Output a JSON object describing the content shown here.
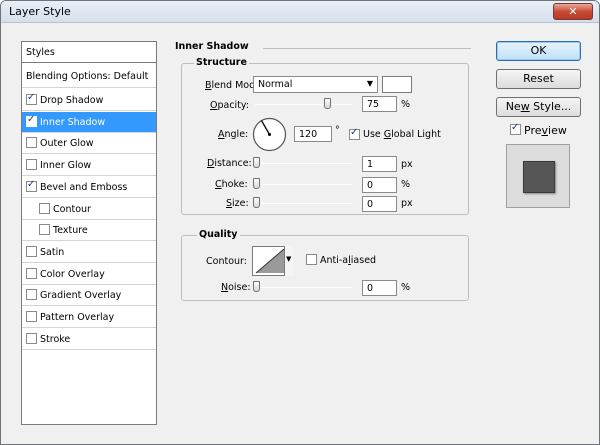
{
  "window": {
    "title": "Layer Style",
    "close_glyph": "✕"
  },
  "styles_list": {
    "header": "Styles",
    "blending": "Blending Options: Default",
    "items": [
      {
        "label": "Drop Shadow",
        "checked": true,
        "selected": false,
        "indent": false
      },
      {
        "label": "Inner Shadow",
        "checked": true,
        "selected": true,
        "indent": false
      },
      {
        "label": "Outer Glow",
        "checked": false,
        "selected": false,
        "indent": false
      },
      {
        "label": "Inner Glow",
        "checked": false,
        "selected": false,
        "indent": false
      },
      {
        "label": "Bevel and Emboss",
        "checked": true,
        "selected": false,
        "indent": false
      },
      {
        "label": "Contour",
        "checked": false,
        "selected": false,
        "indent": true
      },
      {
        "label": "Texture",
        "checked": false,
        "selected": false,
        "indent": true
      },
      {
        "label": "Satin",
        "checked": false,
        "selected": false,
        "indent": false
      },
      {
        "label": "Color Overlay",
        "checked": false,
        "selected": false,
        "indent": false
      },
      {
        "label": "Gradient Overlay",
        "checked": false,
        "selected": false,
        "indent": false
      },
      {
        "label": "Pattern Overlay",
        "checked": false,
        "selected": false,
        "indent": false
      },
      {
        "label": "Stroke",
        "checked": false,
        "selected": false,
        "indent": false
      }
    ]
  },
  "inner_shadow": {
    "title": "Inner Shadow",
    "structure": {
      "title": "Structure",
      "blend_mode_label_u": "B",
      "blend_mode_label_rest": "lend Mode:",
      "blend_mode_value": "Normal",
      "shadow_color": "#ffffff",
      "opacity_label_u": "O",
      "opacity_label_rest": "pacity:",
      "opacity_value": "75",
      "opacity_unit": "%",
      "opacity_level": 0.75,
      "angle_label_u": "A",
      "angle_label_rest": "ngle:",
      "angle_value": "120",
      "angle_unit": "°",
      "use_global_light_pre": "Use ",
      "use_global_light_u": "G",
      "use_global_light_post": "lobal Light",
      "use_global_light_checked": true,
      "distance_label_u": "D",
      "distance_label_rest": "istance:",
      "distance_value": "1",
      "distance_unit": "px",
      "choke_label_u": "C",
      "choke_label_rest": "hoke:",
      "choke_value": "0",
      "choke_unit": "%",
      "size_label_u": "S",
      "size_label_rest": "ize:",
      "size_value": "0",
      "size_unit": "px"
    },
    "quality": {
      "title": "Quality",
      "contour_label": "Contour:",
      "anti_aliased_pre": "Anti-a",
      "anti_aliased_u": "l",
      "anti_aliased_post": "iased",
      "anti_aliased_checked": false,
      "noise_label_u": "N",
      "noise_label_rest": "oise:",
      "noise_value": "0",
      "noise_unit": "%"
    }
  },
  "buttons": {
    "ok": "OK",
    "reset": "Reset",
    "new_style_pre": "Ne",
    "new_style_u": "w",
    "new_style_post": " Style...",
    "preview_pre": "Pre",
    "preview_u": "v",
    "preview_post": "iew",
    "preview_checked": true
  }
}
